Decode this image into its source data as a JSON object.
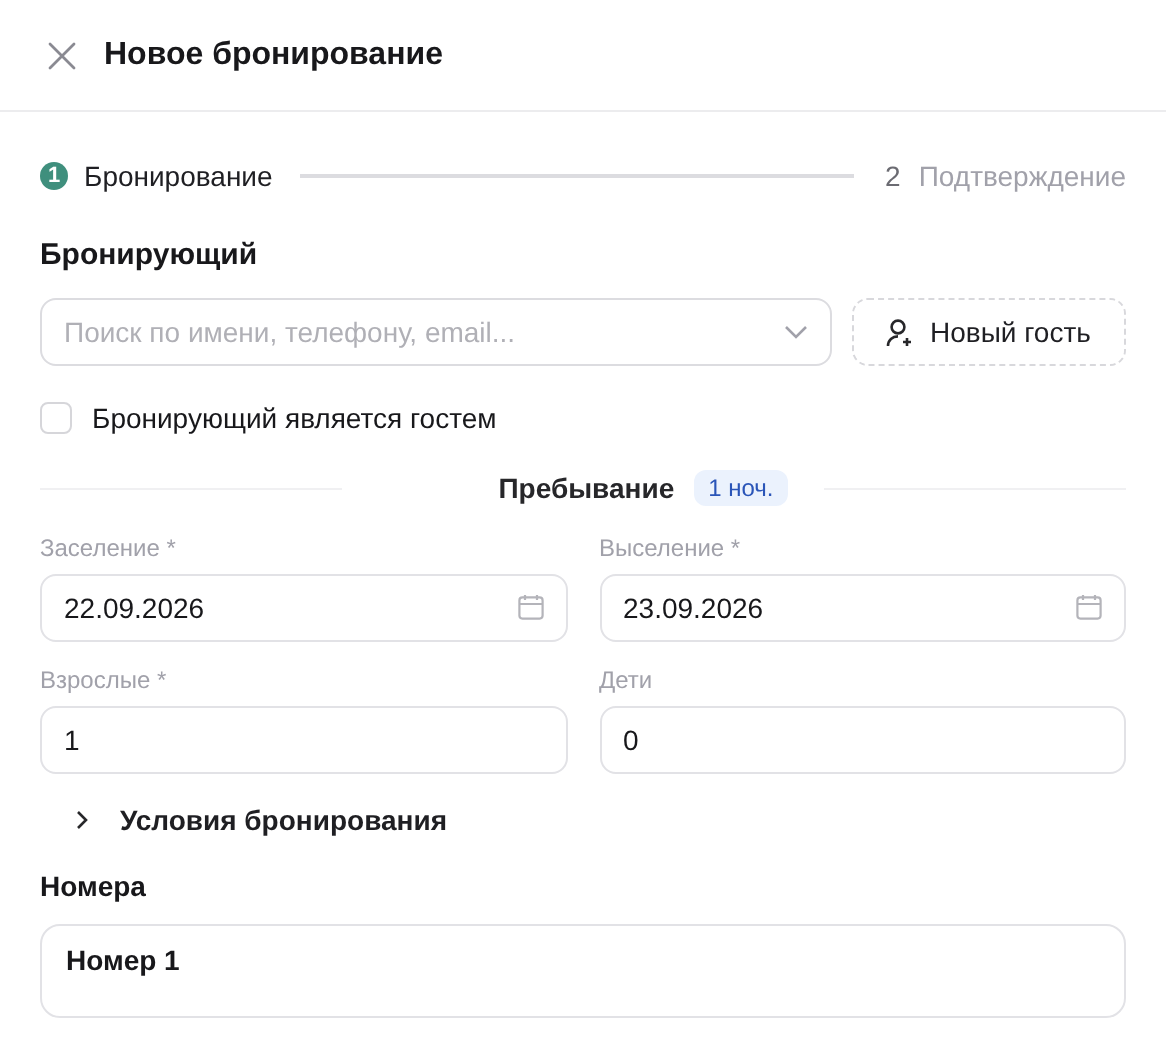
{
  "header": {
    "title": "Новое бронирование"
  },
  "steps": [
    {
      "number": "1",
      "label": "Бронирование",
      "selected": true
    },
    {
      "number": "2",
      "label": "Подтверждение",
      "selected": false
    }
  ],
  "booker": {
    "title": "Бронирующий",
    "search": {
      "placeholder": "Поиск по имени, телефону, email..."
    },
    "new_guest_button": "Новый гость",
    "is_guest": {
      "label": "Бронирующий является гостем",
      "checked": false
    }
  },
  "stay": {
    "title": "Пребывание",
    "nights_badge": "1 ноч.",
    "fields": [
      {
        "label": "Заселение *",
        "value": "22.09.2026",
        "kind": "date"
      },
      {
        "label": "Выселение *",
        "value": "23.09.2026",
        "kind": "date"
      },
      {
        "label": "Взрослые *",
        "value": "1",
        "kind": "number"
      },
      {
        "label": "Дети",
        "value": "0",
        "kind": "number"
      }
    ]
  },
  "conditions": {
    "label": "Условия бронирования",
    "expanded": false
  },
  "rooms": {
    "title": "Номера",
    "items": [
      {
        "title": "Номер 1"
      }
    ]
  }
}
